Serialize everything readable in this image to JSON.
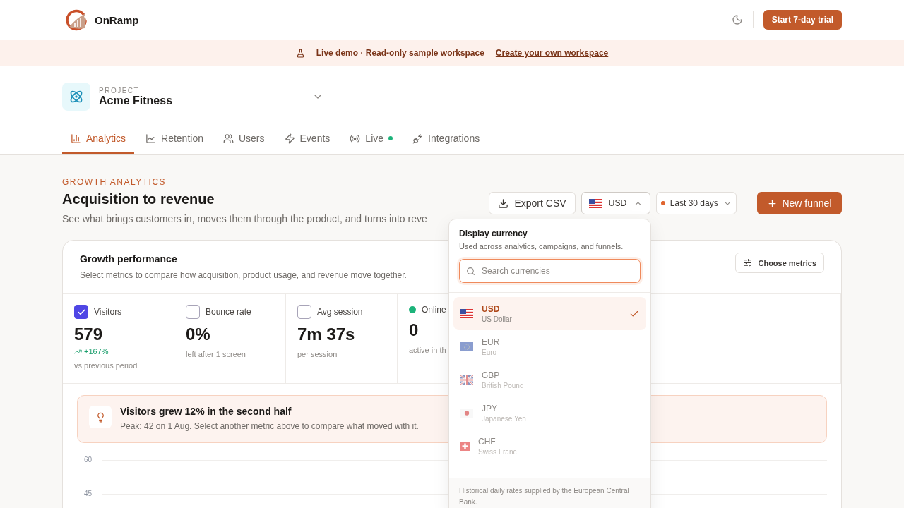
{
  "brand": {
    "name": "OnRamp"
  },
  "header": {
    "trial_button": "Start 7-day trial"
  },
  "banner": {
    "text": "Live demo · Read-only sample workspace",
    "link": "Create your own workspace"
  },
  "project": {
    "label": "PROJECT",
    "name": "Acme Fitness"
  },
  "tabs": [
    {
      "label": "Analytics",
      "kind": "bars",
      "selected": true,
      "live": false
    },
    {
      "label": "Retention",
      "kind": "line",
      "selected": false,
      "live": false
    },
    {
      "label": "Users",
      "kind": "users",
      "selected": false,
      "live": false
    },
    {
      "label": "Events",
      "kind": "zap",
      "selected": false,
      "live": false
    },
    {
      "label": "Live",
      "kind": "radio",
      "selected": false,
      "live": true
    },
    {
      "label": "Integrations",
      "kind": "plug",
      "selected": false,
      "live": false
    }
  ],
  "section": {
    "eyebrow": "GROWTH ANALYTICS",
    "title": "Acquisition to revenue",
    "subtitle": "See what brings customers in, moves them through the product, and turns into reve"
  },
  "toolbar": {
    "export": "Export CSV",
    "currency": "USD",
    "range": "Last 30 days",
    "new_funnel": "New funnel"
  },
  "card": {
    "title": "Growth performance",
    "subtitle": "Select metrics to compare how acquisition, product usage, and revenue move together.",
    "choose_metrics": "Choose metrics",
    "metrics": [
      {
        "kind": "checkbox",
        "label": "Visitors",
        "checked": true,
        "value": "579",
        "change": "+167%",
        "note": "vs previous period"
      },
      {
        "kind": "checkbox",
        "label": "Bounce rate",
        "checked": false,
        "value": "0%",
        "note": "left after 1 screen"
      },
      {
        "kind": "checkbox",
        "label": "Avg session",
        "checked": false,
        "value": "7m 37s",
        "note": "per session"
      },
      {
        "kind": "live",
        "label": "Online",
        "value": "0",
        "note": "active in th"
      }
    ],
    "insight": {
      "title": "Visitors grew 12% in the second half",
      "text": "Peak: 42 on 1 Aug. Select another metric above to compare what moved with it."
    },
    "y_ticks": [
      "60",
      "45"
    ]
  },
  "currency_menu": {
    "title": "Display currency",
    "subtitle": "Used across analytics, campaigns, and funnels.",
    "search": {
      "placeholder": "Search currencies"
    },
    "items": [
      {
        "kind": "us",
        "code": "USD",
        "name": "US Dollar",
        "selected": true
      },
      {
        "kind": "eu",
        "code": "EUR",
        "name": "Euro",
        "selected": false
      },
      {
        "kind": "gb",
        "code": "GBP",
        "name": "British Pound",
        "selected": false
      },
      {
        "kind": "jp",
        "code": "JPY",
        "name": "Japanese Yen",
        "selected": false
      },
      {
        "kind": "ch",
        "code": "CHF",
        "name": "Swiss Franc",
        "selected": false
      }
    ],
    "footer": "Historical daily rates supplied by the European Central Bank."
  }
}
